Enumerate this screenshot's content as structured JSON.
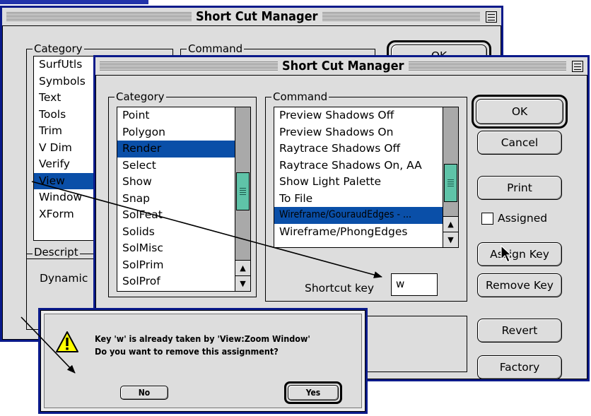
{
  "back_window": {
    "title": "Short Cut Manager",
    "category_label": "Category",
    "command_label": "Command",
    "categories": [
      "SurfUtls",
      "Symbols",
      "Text",
      "Tools",
      "Trim",
      "V Dim",
      "Verify",
      "View",
      "Window",
      "XForm"
    ],
    "selected_category": "View",
    "description_label": "Descript",
    "description_text": "Dynamic",
    "ok_partial": "OK"
  },
  "front_window": {
    "title": "Short Cut Manager",
    "category_label": "Category",
    "command_label": "Command",
    "categories": [
      "Point",
      "Polygon",
      "Render",
      "Select",
      "Show",
      "Snap",
      "SolFeat",
      "Solids",
      "SolMisc",
      "SolPrim",
      "SolProf"
    ],
    "selected_category": "Render",
    "commands": [
      "Preview Shadows Off",
      "Preview Shadows On",
      "Raytrace Shadows Off",
      "Raytrace Shadows On, AA",
      "Show Light Palette",
      "To File",
      "Wireframe/GouraudEdges - ...",
      "Wireframe/PhongEdges"
    ],
    "selected_command": "Wireframe/GouraudEdges - ...",
    "shortcut_label": "Shortcut key",
    "shortcut_value": "w",
    "buttons": {
      "ok": "OK",
      "cancel": "Cancel",
      "print": "Print",
      "assigned": "Assigned",
      "assign_key": "Assign Key",
      "remove_key": "Remove Key",
      "revert": "Revert",
      "factory": "Factory"
    },
    "assigned_checked": false
  },
  "alert": {
    "line1": "Key 'w' is already taken by 'View:Zoom Window'",
    "line2": "Do you want to remove this assignment?",
    "no_label": "No",
    "yes_label": "Yes"
  },
  "colors": {
    "window_frame": "#0a1a8a",
    "selection": "#0a4fa8",
    "scroll_thumb": "#5fc3a8",
    "window_bg": "#dddddd"
  }
}
